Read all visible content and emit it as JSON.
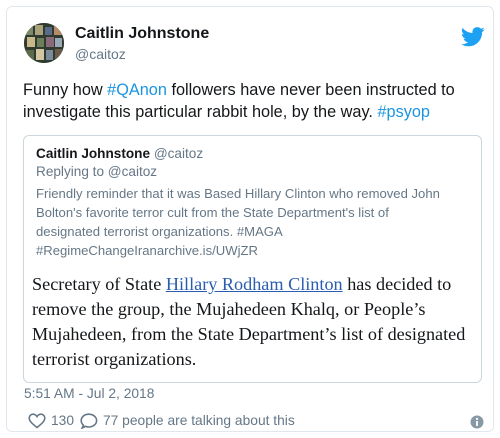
{
  "author": {
    "name": "Caitlin Johnstone",
    "handle": "@caitoz"
  },
  "tweet": {
    "text_line1_a": "Funny how ",
    "text_line1_tag": "#QAnon",
    "text_line1_b": " followers have never been instructed to",
    "text_line2_a": "investigate this particular rabbit hole, by the way. ",
    "text_line2_tag": "#psyop"
  },
  "quoted": {
    "name": "Caitlin Johnstone",
    "handle": "@caitoz",
    "replying_to": "Replying to @caitoz",
    "text_line1": "Friendly reminder that it was Based Hillary Clinton who removed John",
    "text_line2": "Bolton's favorite terror cult from the State Department's list of",
    "text_line3": "designated terrorist organizations. #MAGA",
    "text_line4": "#RegimeChangeIranarchive.is/UWjZR",
    "quote_a": "Secretary of State ",
    "quote_link": "Hillary Rodham Clinton",
    "quote_b": " has decided to",
    "quote_line2": "remove the group, the Mujahedeen Khalq, or People’s",
    "quote_line3": "Mujahedeen, from the State Department’s list of designated",
    "quote_line4": "terrorist organizations."
  },
  "timestamp": "5:51 AM - Jul 2, 2018",
  "stats": {
    "likes": "130",
    "talking": "77 people are talking about this"
  },
  "icons": {
    "brand": "twitter-bird-icon",
    "like": "heart-icon",
    "reply": "reply-bubble-icon",
    "info": "info-icon"
  },
  "colors": {
    "link_blue": "#1b95e0",
    "muted": "#657786",
    "quote_link": "#2a5db0"
  }
}
